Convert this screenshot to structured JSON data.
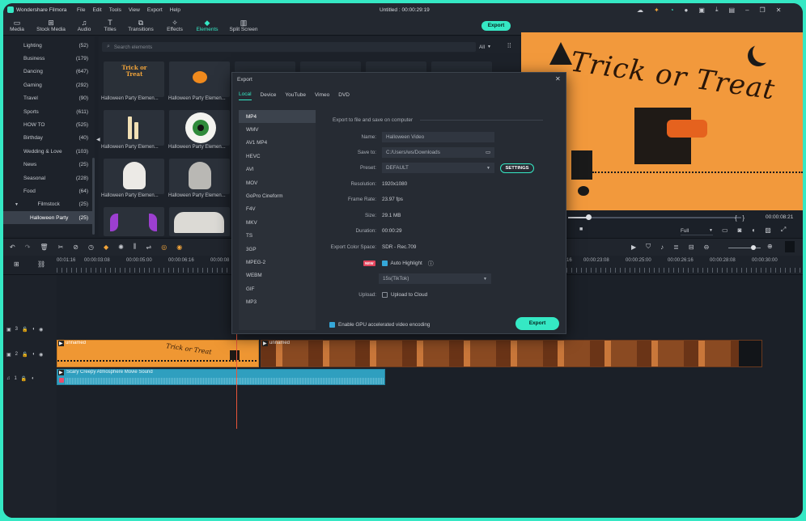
{
  "app": {
    "name": "Wondershare Filmora",
    "title": "Untitled : 00:00:29:19"
  },
  "menu": [
    "File",
    "Edit",
    "Tools",
    "View",
    "Export",
    "Help"
  ],
  "toolbar": {
    "tabs": [
      {
        "label": "Media",
        "icon": "folder-icon"
      },
      {
        "label": "Stock Media",
        "icon": "stock-media-icon"
      },
      {
        "label": "Audio",
        "icon": "music-icon"
      },
      {
        "label": "Titles",
        "icon": "titles-icon"
      },
      {
        "label": "Transitions",
        "icon": "transitions-icon"
      },
      {
        "label": "Effects",
        "icon": "effects-icon"
      },
      {
        "label": "Elements",
        "icon": "elements-icon"
      },
      {
        "label": "Split Screen",
        "icon": "split-screen-icon"
      }
    ],
    "active": "Elements",
    "export_label": "Export"
  },
  "sidebar": {
    "categories": [
      {
        "label": "Lighting",
        "count": "(52)"
      },
      {
        "label": "Business",
        "count": "(179)"
      },
      {
        "label": "Dancing",
        "count": "(647)"
      },
      {
        "label": "Gaming",
        "count": "(292)"
      },
      {
        "label": "Travel",
        "count": "(90)"
      },
      {
        "label": "Sports",
        "count": "(611)"
      },
      {
        "label": "HOW TO",
        "count": "(525)"
      },
      {
        "label": "Birthday",
        "count": "(40)"
      },
      {
        "label": "Wedding & Love",
        "count": "(103)"
      },
      {
        "label": "News",
        "count": "(25)"
      },
      {
        "label": "Seasonal",
        "count": "(228)"
      },
      {
        "label": "Food",
        "count": "(64)"
      },
      {
        "label": "Filmstock",
        "count": "(25)"
      },
      {
        "label": "Halloween Party",
        "count": "(25)"
      }
    ]
  },
  "library": {
    "search_placeholder": "Search elements",
    "filter": "All",
    "items": [
      "Halloween Party Elemen...",
      "Halloween Party Elemen...",
      "Halloween Party Elemen...",
      "Halloween Party Elemen...",
      "Halloween Party Elemen...",
      "Halloween Party Elemen..."
    ],
    "thumb_text": "Trick or Treat"
  },
  "preview": {
    "title_text": "Trick or Treat",
    "timecode": "00:00:08:21",
    "quality": "Full",
    "brackets": "{   }"
  },
  "timeline": {
    "ruler": [
      "00:01:16",
      "00:00:03:08",
      "00:00:05:00",
      "00:00:06:16",
      "00:00:08",
      "00:00:23:08",
      "00:00:25:00",
      "00:00:26:16",
      "00:00:28:08",
      "00:00:30:00",
      "16"
    ],
    "tracks": [
      {
        "label": "3"
      },
      {
        "label": "2"
      },
      {
        "label": "1"
      }
    ],
    "clip_video_1": "unnamed",
    "clip_video_2": "unnamed",
    "clip_video_text": "Trick or Treat",
    "clip_audio": "Scary Creepy Atmosphere Movie Sound"
  },
  "export_dialog": {
    "title": "Export",
    "tabs": [
      "Local",
      "Device",
      "YouTube",
      "Vimeo",
      "DVD"
    ],
    "selected_tab": "Local",
    "formats": [
      "MP4",
      "WMV",
      "AV1 MP4",
      "HEVC",
      "AVI",
      "MOV",
      "GoPro Cineform",
      "F4V",
      "MKV",
      "TS",
      "3GP",
      "MPEG-2",
      "WEBM",
      "GIF",
      "MP3"
    ],
    "selected_format": "MP4",
    "heading": "Export to file and save on computer",
    "fields": {
      "name_label": "Name:",
      "name_value": "Halloween Video",
      "saveto_label": "Save to:",
      "saveto_value": "C:/Users/ws/Downloads",
      "preset_label": "Preset:",
      "preset_value": "DEFAULT",
      "settings_label": "SETTINGS",
      "resolution_label": "Resolution:",
      "resolution_value": "1920x1080",
      "framerate_label": "Frame Rate:",
      "framerate_value": "23.97 fps",
      "size_label": "Size:",
      "size_value": "29.1 MB",
      "duration_label": "Duration:",
      "duration_value": "00:00:29",
      "colorspace_label": "Export Color Space:",
      "colorspace_value": "SDR - Rec.709",
      "new_badge": "NEW",
      "auto_highlight_label": "Auto Highlight",
      "highlight_option": "15s(TikTok)",
      "upload_label": "Upload:",
      "upload_value": "Upload to Cloud"
    },
    "gpu_label": "Enable GPU accelerated video encoding",
    "export_button": "Export"
  },
  "colors": {
    "accent": "#35e8c4",
    "orange": "#f39a2c",
    "audio": "#2f9fbf",
    "playhead": "#e8553a"
  }
}
